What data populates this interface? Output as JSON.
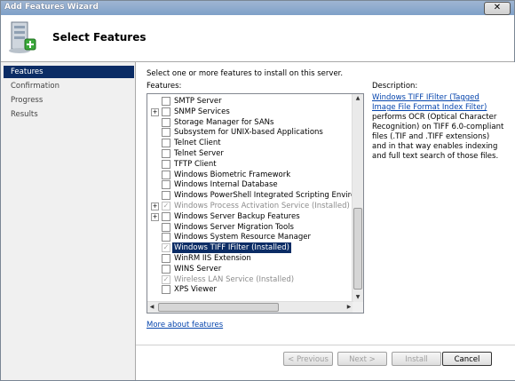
{
  "window": {
    "title": "Add Features Wizard",
    "close_glyph": "✕"
  },
  "header": {
    "title": "Select Features",
    "icon": "server-add-icon"
  },
  "nav": {
    "items": [
      {
        "label": "Features",
        "active": true
      },
      {
        "label": "Confirmation",
        "active": false
      },
      {
        "label": "Progress",
        "active": false
      },
      {
        "label": "Results",
        "active": false
      }
    ]
  },
  "content": {
    "intro": "Select one or more features to install on this server.",
    "features_label": "Features:",
    "description_label": "Description:",
    "description_link": "Windows TIFF IFilter (Tagged Image File Format Index Filter)",
    "description_text": " performs OCR (Optical Character Recognition) on TIFF 6.0-compliant files (.TIF and .TIFF extensions) and in that way enables indexing and full text search of those files.",
    "more_link": "More about features"
  },
  "features": [
    {
      "label": "SMTP Server",
      "checked": false,
      "disabled": false,
      "expandable": false
    },
    {
      "label": "SNMP Services",
      "checked": false,
      "disabled": false,
      "expandable": true
    },
    {
      "label": "Storage Manager for SANs",
      "checked": false,
      "disabled": false,
      "expandable": false
    },
    {
      "label": "Subsystem for UNIX-based Applications",
      "checked": false,
      "disabled": false,
      "expandable": false
    },
    {
      "label": "Telnet Client",
      "checked": false,
      "disabled": false,
      "expandable": false
    },
    {
      "label": "Telnet Server",
      "checked": false,
      "disabled": false,
      "expandable": false
    },
    {
      "label": "TFTP Client",
      "checked": false,
      "disabled": false,
      "expandable": false
    },
    {
      "label": "Windows Biometric Framework",
      "checked": false,
      "disabled": false,
      "expandable": false
    },
    {
      "label": "Windows Internal Database",
      "checked": false,
      "disabled": false,
      "expandable": false
    },
    {
      "label": "Windows PowerShell Integrated Scripting Environment (IS",
      "checked": false,
      "disabled": false,
      "expandable": false
    },
    {
      "label": "Windows Process Activation Service  (Installed)",
      "checked": true,
      "disabled": true,
      "expandable": true
    },
    {
      "label": "Windows Server Backup Features",
      "checked": false,
      "disabled": false,
      "expandable": true
    },
    {
      "label": "Windows Server Migration Tools",
      "checked": false,
      "disabled": false,
      "expandable": false
    },
    {
      "label": "Windows System Resource Manager",
      "checked": false,
      "disabled": false,
      "expandable": false
    },
    {
      "label": "Windows TIFF IFilter  (Installed)",
      "checked": true,
      "disabled": true,
      "expandable": false,
      "selected": true
    },
    {
      "label": "WinRM IIS Extension",
      "checked": false,
      "disabled": false,
      "expandable": false
    },
    {
      "label": "WINS Server",
      "checked": false,
      "disabled": false,
      "expandable": false
    },
    {
      "label": "Wireless LAN Service  (Installed)",
      "checked": true,
      "disabled": true,
      "expandable": false
    },
    {
      "label": "XPS Viewer",
      "checked": false,
      "disabled": false,
      "expandable": false
    }
  ],
  "buttons": {
    "previous": "< Previous",
    "next": "Next >",
    "install": "Install",
    "cancel": "Cancel"
  },
  "glyphs": {
    "plus": "+",
    "check": "✓",
    "up": "▲",
    "down": "▼",
    "left": "◀",
    "right": "▶"
  }
}
